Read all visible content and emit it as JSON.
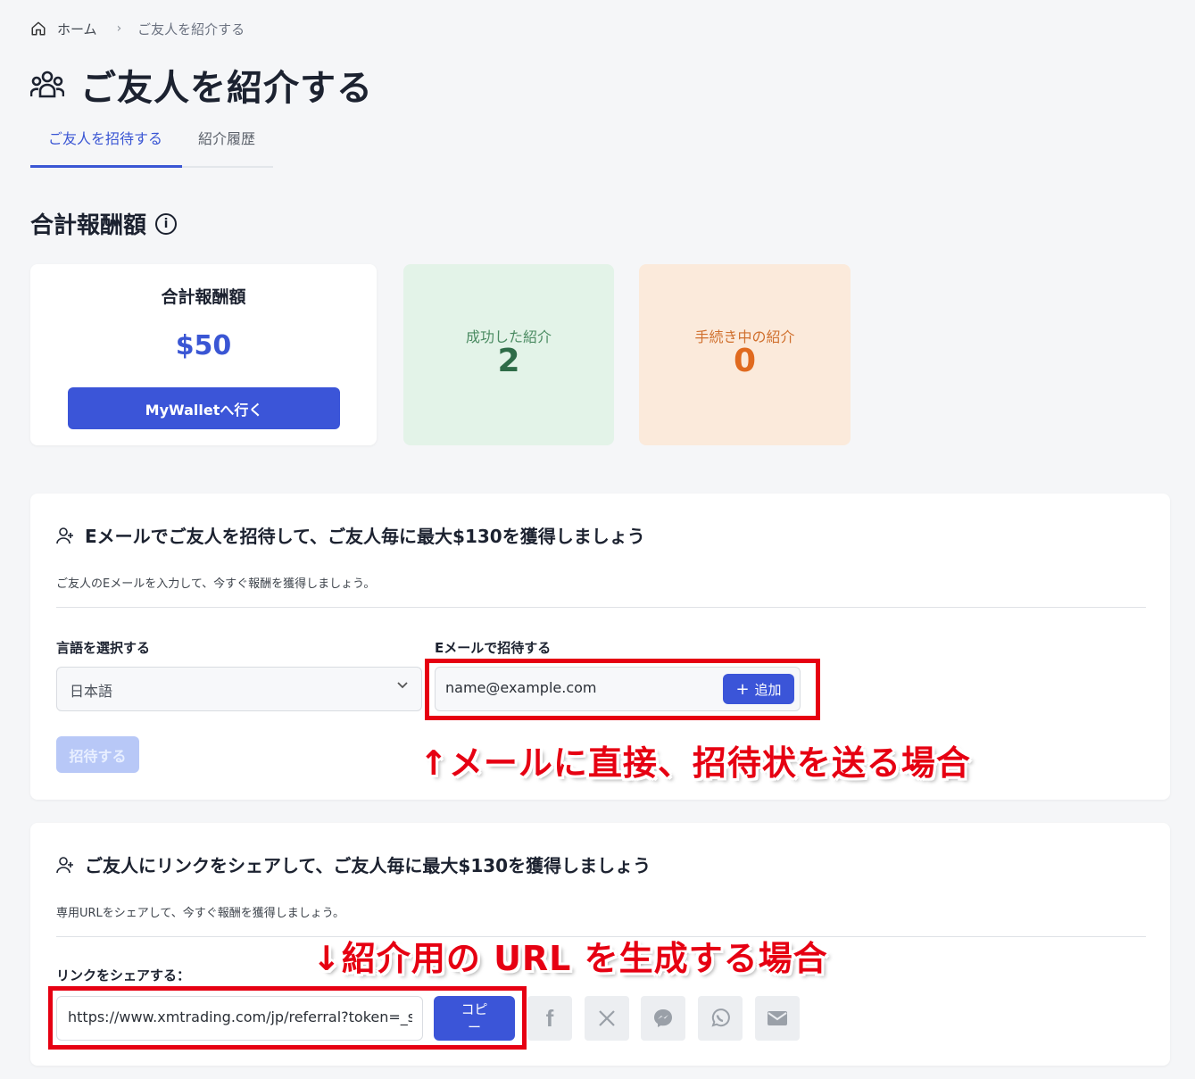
{
  "breadcrumb": {
    "home": "ホーム",
    "separator": "›",
    "current": "ご友人を紹介する"
  },
  "page": {
    "title": "ご友人を紹介する",
    "icon": "users-icon"
  },
  "tabs": [
    {
      "label": "ご友人を招待する",
      "active": true
    },
    {
      "label": "紹介履歴",
      "active": false
    }
  ],
  "rewards": {
    "section_title": "合計報酬額",
    "total_label": "合計報酬額",
    "total_amount": "$50",
    "wallet_button": "MyWalletへ行く",
    "success_label": "成功した紹介",
    "success_count": "2",
    "pending_label": "手続き中の紹介",
    "pending_count": "0"
  },
  "email_invite": {
    "title": "Eメールでご友人を招待して、ご友人毎に最大$130を獲得しましょう",
    "subtitle": "ご友人のEメールを入力して、今すぐ報酬を獲得しましょう。",
    "language_label": "言語を選択する",
    "language_value": "日本語",
    "email_label": "Eメールで招待する",
    "email_placeholder": "name@example.com",
    "add_button": "追加",
    "invite_button": "招待する",
    "annotation": "↑メールに直接、招待状を送る場合"
  },
  "link_share": {
    "title": "ご友人にリンクをシェアして、ご友人毎に最大$130を獲得しましょう",
    "subtitle": "専用URLをシェアして、今すぐ報酬を獲得しましょう。",
    "link_label": "リンクをシェアする：",
    "url": "https://www.xmtrading.com/jp/referral?token=_sFuDFcbzAOpIrQXDLAapmw",
    "copy_button_line1": "コピ",
    "copy_button_line2": "ー",
    "share_icons": [
      "facebook-icon",
      "x-icon",
      "messenger-icon",
      "whatsapp-icon",
      "mail-icon"
    ],
    "annotation": "↓紹介用の URL を生成する場合"
  },
  "colors": {
    "accent": "#3b55d8",
    "annotation": "#e60012",
    "success_bg": "#e3f3e8",
    "pending_bg": "#fbeadb"
  }
}
